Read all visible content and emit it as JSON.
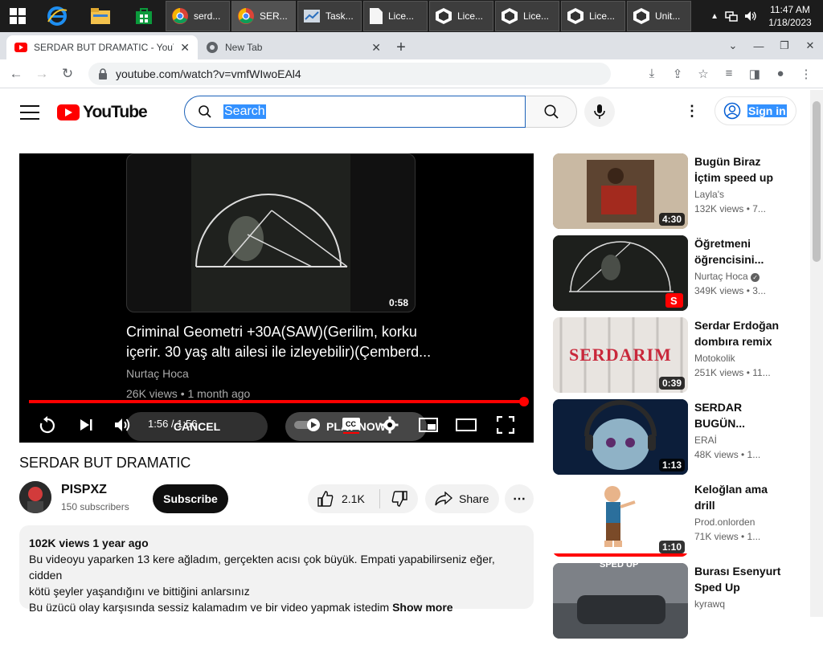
{
  "taskbar": {
    "tasks": [
      {
        "label": "serd..."
      },
      {
        "label": "SER..."
      },
      {
        "label": "Task..."
      },
      {
        "label": "Lice..."
      },
      {
        "label": "Lice..."
      },
      {
        "label": "Lice..."
      },
      {
        "label": "Lice..."
      },
      {
        "label": "Unit..."
      }
    ],
    "time": "11:47 AM",
    "date": "1/18/2023"
  },
  "browser": {
    "tabs": [
      {
        "label": "SERDAR BUT DRAMATIC - YouTube"
      },
      {
        "label": "New Tab"
      }
    ],
    "url": "youtube.com/watch?v=vmfWIwoEAl4"
  },
  "header": {
    "logo_text": "YouTube",
    "search_placeholder": "Search",
    "signin_label": "Sign in"
  },
  "player": {
    "endscreen": {
      "title": "Criminal Geometri +30A(SAW)(Gerilim, korku içerir. 30 yaş altı ailesi ile izleyebilir)(Çemberd...",
      "channel": "Nurtaç Hoca",
      "meta": "26K views • 1 month ago",
      "duration": "0:58",
      "cancel_label": "CANCEL",
      "play_now_label": "PLAY NOW"
    },
    "timecode": "1:56 / 1:56",
    "progress": 1.0
  },
  "video": {
    "title": "SERDAR BUT DRAMATIC",
    "channel": "PISPXZ",
    "subscribers": "150 subscribers",
    "subscribe_label": "Subscribe",
    "likes": "2.1K",
    "share_label": "Share",
    "description": {
      "stats": "102K views  1 year ago",
      "line1": "Bu videoyu yaparken 13 kere ağladım, gerçekten acısı çok büyük. Empati yapabilirseniz eğer, cidden",
      "line2": "kötü şeyler yaşandığını ve bittiğini anlarsınız",
      "line3": "Bu üzücü olay karşısında sessiz kalamadım ve bir video yapmak istedim",
      "show_more": "Show more"
    }
  },
  "recommendations": [
    {
      "title": "Bugün Biraz İçtim speed up",
      "channel": "Layla's",
      "meta": "132K views • 7...",
      "duration": "4:30",
      "thumb_color": "#8a6a4a"
    },
    {
      "title": "Öğretmeni öğrencisini...",
      "channel": "Nurtaç Hoca",
      "meta": "349K views • 3...",
      "duration": "",
      "thumb_color": "#1d1f1c"
    },
    {
      "title": "Serdar Erdoğan dombıra remix",
      "channel": "Motokolik",
      "meta": "251K views • 11...",
      "duration": "0:39",
      "thumb_color": "#e8e4e0",
      "thumb_text": "SERDARIM"
    },
    {
      "title": "SERDAR BUGÜN...",
      "channel": "ERAİ",
      "meta": "48K views • 1...",
      "duration": "1:13",
      "thumb_color": "#0c1e3a"
    },
    {
      "title": "Keloğlan ama drill",
      "channel": "Prod.onlorden",
      "meta": "71K views • 1...",
      "duration": "1:10",
      "thumb_color": "#ffffff"
    },
    {
      "title": "Burası Esenyurt Sped Up",
      "channel": "kyrawq",
      "meta": "",
      "duration": "",
      "thumb_color": "#6b6f73",
      "thumb_text": "SPED UP"
    }
  ]
}
